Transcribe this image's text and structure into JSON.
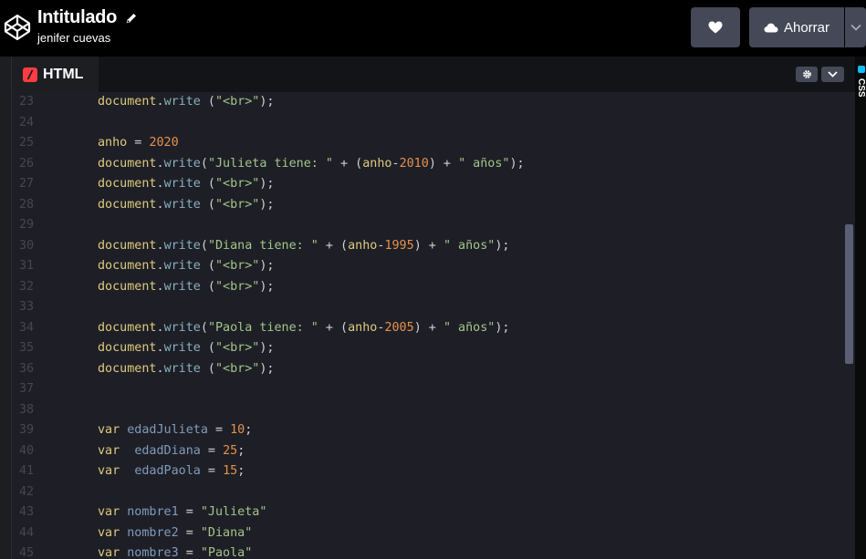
{
  "header": {
    "title": "Intitulado",
    "author": "jenifer cuevas",
    "save_label": "Ahorrar"
  },
  "icons": {
    "logo": "codepen-logo-icon",
    "pencil": "pencil-icon",
    "heart": "heart-icon",
    "cloud": "cloud-icon",
    "caret": "chevron-down-icon",
    "settings": "gear-icon"
  },
  "editor": {
    "tab_label": "HTML",
    "side_tab_label": "CSS",
    "lines": [
      {
        "n": "23",
        "tokens": [
          [
            "kw",
            "document"
          ],
          [
            "op",
            "."
          ],
          [
            "pl",
            "write"
          ],
          [
            "op",
            " ("
          ],
          [
            "st",
            "\"<br>\""
          ],
          [
            "op",
            ");"
          ]
        ]
      },
      {
        "n": "24",
        "tokens": []
      },
      {
        "n": "25",
        "tokens": [
          [
            "kw",
            "anho"
          ],
          [
            "op",
            " = "
          ],
          [
            "nm",
            "2020"
          ]
        ]
      },
      {
        "n": "26",
        "tokens": [
          [
            "kw",
            "document"
          ],
          [
            "op",
            "."
          ],
          [
            "pl",
            "write"
          ],
          [
            "op",
            "("
          ],
          [
            "st",
            "\"Julieta tiene: \""
          ],
          [
            "op",
            " + ("
          ],
          [
            "kw",
            "anho"
          ],
          [
            "op",
            "-"
          ],
          [
            "nm",
            "2010"
          ],
          [
            "op",
            ") + "
          ],
          [
            "st",
            "\" años\""
          ],
          [
            "op",
            ");"
          ]
        ]
      },
      {
        "n": "27",
        "tokens": [
          [
            "kw",
            "document"
          ],
          [
            "op",
            "."
          ],
          [
            "pl",
            "write"
          ],
          [
            "op",
            " ("
          ],
          [
            "st",
            "\"<br>\""
          ],
          [
            "op",
            ");"
          ]
        ]
      },
      {
        "n": "28",
        "tokens": [
          [
            "kw",
            "document"
          ],
          [
            "op",
            "."
          ],
          [
            "pl",
            "write"
          ],
          [
            "op",
            " ("
          ],
          [
            "st",
            "\"<br>\""
          ],
          [
            "op",
            ");"
          ]
        ]
      },
      {
        "n": "29",
        "tokens": []
      },
      {
        "n": "30",
        "tokens": [
          [
            "kw",
            "document"
          ],
          [
            "op",
            "."
          ],
          [
            "pl",
            "write"
          ],
          [
            "op",
            "("
          ],
          [
            "st",
            "\"Diana tiene: \""
          ],
          [
            "op",
            " + ("
          ],
          [
            "kw",
            "anho"
          ],
          [
            "op",
            "-"
          ],
          [
            "nm",
            "1995"
          ],
          [
            "op",
            ") + "
          ],
          [
            "st",
            "\" años\""
          ],
          [
            "op",
            ");"
          ]
        ]
      },
      {
        "n": "31",
        "tokens": [
          [
            "kw",
            "document"
          ],
          [
            "op",
            "."
          ],
          [
            "pl",
            "write"
          ],
          [
            "op",
            " ("
          ],
          [
            "st",
            "\"<br>\""
          ],
          [
            "op",
            ");"
          ]
        ]
      },
      {
        "n": "32",
        "tokens": [
          [
            "kw",
            "document"
          ],
          [
            "op",
            "."
          ],
          [
            "pl",
            "write"
          ],
          [
            "op",
            " ("
          ],
          [
            "st",
            "\"<br>\""
          ],
          [
            "op",
            ");"
          ]
        ]
      },
      {
        "n": "33",
        "tokens": []
      },
      {
        "n": "34",
        "tokens": [
          [
            "kw",
            "document"
          ],
          [
            "op",
            "."
          ],
          [
            "pl",
            "write"
          ],
          [
            "op",
            "("
          ],
          [
            "st",
            "\"Paola tiene: \""
          ],
          [
            "op",
            " + ("
          ],
          [
            "kw",
            "anho"
          ],
          [
            "op",
            "-"
          ],
          [
            "nm",
            "2005"
          ],
          [
            "op",
            ") + "
          ],
          [
            "st",
            "\" años\""
          ],
          [
            "op",
            ");"
          ]
        ]
      },
      {
        "n": "35",
        "tokens": [
          [
            "kw",
            "document"
          ],
          [
            "op",
            "."
          ],
          [
            "pl",
            "write"
          ],
          [
            "op",
            " ("
          ],
          [
            "st",
            "\"<br>\""
          ],
          [
            "op",
            ");"
          ]
        ]
      },
      {
        "n": "36",
        "tokens": [
          [
            "kw",
            "document"
          ],
          [
            "op",
            "."
          ],
          [
            "pl",
            "write"
          ],
          [
            "op",
            " ("
          ],
          [
            "st",
            "\"<br>\""
          ],
          [
            "op",
            ");"
          ]
        ]
      },
      {
        "n": "37",
        "tokens": []
      },
      {
        "n": "38",
        "tokens": []
      },
      {
        "n": "39",
        "tokens": [
          [
            "kw",
            "var"
          ],
          [
            "op",
            " "
          ],
          [
            "va",
            "edadJulieta"
          ],
          [
            "op",
            " = "
          ],
          [
            "nm",
            "10"
          ],
          [
            "op",
            ";"
          ]
        ]
      },
      {
        "n": "40",
        "tokens": [
          [
            "kw",
            "var"
          ],
          [
            "op",
            "  "
          ],
          [
            "va",
            "edadDiana"
          ],
          [
            "op",
            " = "
          ],
          [
            "nm",
            "25"
          ],
          [
            "op",
            ";"
          ]
        ]
      },
      {
        "n": "41",
        "tokens": [
          [
            "kw",
            "var"
          ],
          [
            "op",
            "  "
          ],
          [
            "va",
            "edadPaola"
          ],
          [
            "op",
            " = "
          ],
          [
            "nm",
            "15"
          ],
          [
            "op",
            ";"
          ]
        ]
      },
      {
        "n": "42",
        "tokens": []
      },
      {
        "n": "43",
        "tokens": [
          [
            "kw",
            "var"
          ],
          [
            "op",
            " "
          ],
          [
            "va",
            "nombre1"
          ],
          [
            "op",
            " = "
          ],
          [
            "st",
            "\"Julieta\""
          ]
        ]
      },
      {
        "n": "44",
        "tokens": [
          [
            "kw",
            "var"
          ],
          [
            "op",
            " "
          ],
          [
            "va",
            "nombre2"
          ],
          [
            "op",
            " = "
          ],
          [
            "st",
            "\"Diana\""
          ]
        ]
      },
      {
        "n": "45",
        "tokens": [
          [
            "kw",
            "var"
          ],
          [
            "op",
            " "
          ],
          [
            "va",
            "nombre3"
          ],
          [
            "op",
            " = "
          ],
          [
            "st",
            "\"Paola\""
          ]
        ]
      }
    ]
  },
  "colors": {
    "accent_html": "#ff3c41",
    "accent_css": "#0ebeff",
    "button_bg": "#444857"
  }
}
